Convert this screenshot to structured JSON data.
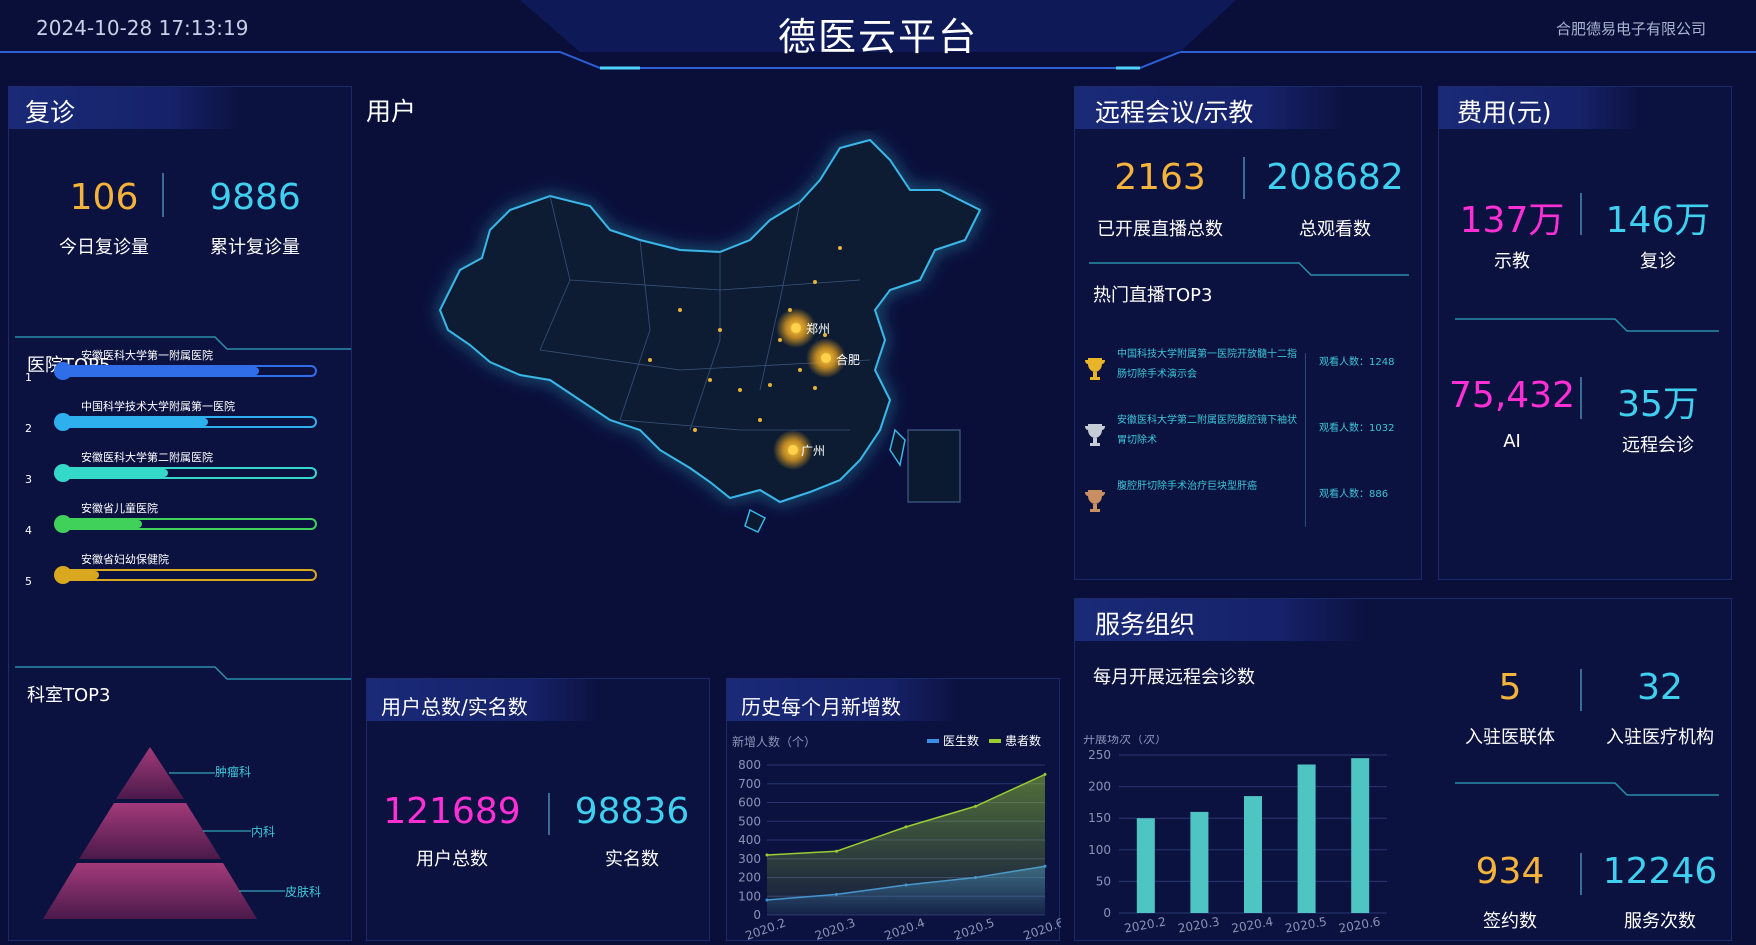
{
  "header": {
    "datetime": "2024-10-28 17:13:19",
    "title": "德医云平台",
    "company": "合肥德易电子有限公司"
  },
  "revisit": {
    "title": "复诊",
    "today_value": "106",
    "today_label": "今日复诊量",
    "total_value": "9886",
    "total_label": "累计复诊量",
    "hospital_top_title": "医院TOP5",
    "hospitals": [
      {
        "rank": "1",
        "name": "安徽医科大学第一附属医院",
        "fill": 0.78,
        "color": "#2f6ee8"
      },
      {
        "rank": "2",
        "name": "中国科学技术大学附属第一医院",
        "fill": 0.58,
        "color": "#2fb0ee"
      },
      {
        "rank": "3",
        "name": "安徽医科大学第二附属医院",
        "fill": 0.42,
        "color": "#34d9c9"
      },
      {
        "rank": "4",
        "name": "安徽省儿童医院",
        "fill": 0.32,
        "color": "#3fd15a"
      },
      {
        "rank": "5",
        "name": "安徽省妇幼保健院",
        "fill": 0.15,
        "color": "#d9a81e"
      }
    ],
    "dept_top_title": "科室TOP3",
    "depts": [
      "肿瘤科",
      "内科",
      "皮肤科"
    ]
  },
  "users": {
    "title": "用户",
    "cities": [
      "郑州",
      "合肥",
      "广州"
    ],
    "totals_title": "用户总数/实名数",
    "total_value": "121689",
    "total_label": "用户总数",
    "real_value": "98836",
    "real_label": "实名数"
  },
  "monthly_chart": {
    "title": "历史每个月新增数"
  },
  "remote": {
    "title": "远程会议/示教",
    "live_value": "2163",
    "live_label": "已开展直播总数",
    "views_value": "208682",
    "views_label": "总观看数",
    "hot_title": "热门直播TOP3",
    "hot": [
      {
        "name": "中国科技大学附属第一医院开放髓十二指肠切除手术演示会",
        "viewers": "观看人数：1248",
        "cup": "#e8b52a"
      },
      {
        "name": "安徽医科大学第二附属医院腹腔镜下袖状胃切除术",
        "viewers": "观看人数：1032",
        "cup": "#c6ccd6"
      },
      {
        "name": "腹腔肝切除手术治疗巨块型肝癌",
        "viewers": "观看人数：886",
        "cup": "#c98f62"
      }
    ]
  },
  "fees": {
    "title": "费用(元)",
    "items": [
      {
        "value": "137万",
        "label": "示教",
        "color": "#ff2fd6"
      },
      {
        "value": "146万",
        "label": "复诊",
        "color": "#3fd0f0"
      },
      {
        "value": "75,432",
        "label": "AI",
        "color": "#ff2fd6"
      },
      {
        "value": "35万",
        "label": "远程会诊",
        "color": "#3fd0f0"
      }
    ]
  },
  "service": {
    "title": "服务组织",
    "chart_title": "每月开展远程会诊数",
    "items": [
      {
        "value": "5",
        "label": "入驻医联体",
        "color": "#f4b33a"
      },
      {
        "value": "32",
        "label": "入驻医疗机构",
        "color": "#3fd0f0"
      },
      {
        "value": "934",
        "label": "签约数",
        "color": "#f4b33a"
      },
      {
        "value": "12246",
        "label": "服务次数",
        "color": "#3fd0f0"
      }
    ]
  },
  "chart_data": [
    {
      "type": "area",
      "title": "",
      "ylabel": "新增人数（个）",
      "categories": [
        "2020.2",
        "2020.3",
        "2020.4",
        "2020.5",
        "2020.6"
      ],
      "ylim": [
        0,
        800
      ],
      "yticks": [
        0,
        100,
        200,
        300,
        400,
        500,
        600,
        700,
        800
      ],
      "legend_position": "top-right",
      "series": [
        {
          "name": "医生数",
          "color": "#3a8ee6",
          "values": [
            80,
            110,
            160,
            200,
            260
          ]
        },
        {
          "name": "患者数",
          "color": "#9acd32",
          "values": [
            320,
            340,
            470,
            580,
            750
          ]
        }
      ]
    },
    {
      "type": "bar",
      "title": "",
      "ylabel": "开展场次（次）",
      "categories": [
        "2020.2",
        "2020.3",
        "2020.4",
        "2020.5",
        "2020.6"
      ],
      "values": [
        150,
        160,
        185,
        235,
        245
      ],
      "ylim": [
        0,
        250
      ],
      "yticks": [
        0,
        50,
        100,
        150,
        200,
        250
      ],
      "color": "#4fc5c3"
    }
  ]
}
